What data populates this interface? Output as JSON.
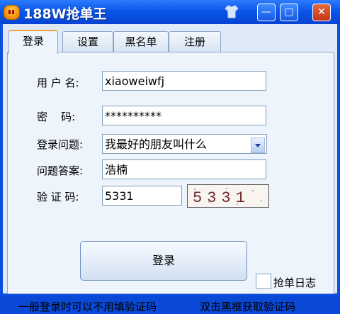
{
  "app": {
    "title": "188W抢单王",
    "window_buttons": {
      "minimize": "—",
      "maximize": "□",
      "close": "✕"
    },
    "skin_icon": "shirt-icon"
  },
  "tabs": [
    {
      "label": "登录",
      "active": true
    },
    {
      "label": "设置"
    },
    {
      "label": "黑名单"
    },
    {
      "label": "注册"
    }
  ],
  "form": {
    "username_label": "用 户 名:",
    "username_value": "xiaoweiwfj",
    "password_label": "密    码:",
    "password_value": "**********",
    "question_label": "登录问题:",
    "question_value": "我最好的朋友叫什么",
    "answer_label": "问题答案:",
    "answer_value": "浩楠",
    "captcha_label": "验 证 码:",
    "captcha_value": "5331",
    "captcha_image_text": "5331"
  },
  "login_button": "登录",
  "order_log_label": "抢单日志",
  "hints": {
    "left": "一般登录时可以不用填验证码",
    "right": "双击黑框获取验证码"
  },
  "colors": {
    "title_bar": "#0a56e8",
    "active_tab_accent": "#f2a23a",
    "panel_bg": "#eef4fc"
  }
}
